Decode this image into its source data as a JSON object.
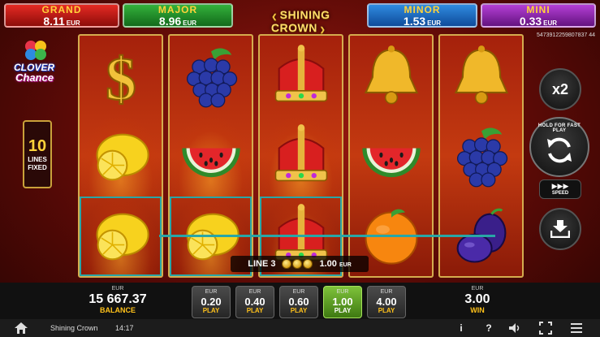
{
  "jackpots": {
    "grand": {
      "name": "GRAND",
      "value": "8.11",
      "currency": "EUR"
    },
    "major": {
      "name": "MAJOR",
      "value": "8.96",
      "currency": "EUR"
    },
    "minor": {
      "name": "MINOR",
      "value": "1.53",
      "currency": "EUR"
    },
    "mini": {
      "name": "MINI",
      "value": "0.33",
      "currency": "EUR"
    }
  },
  "game_title": "SHINING CROWN",
  "session_id": "5473912259807837 44",
  "logo": {
    "line1": "CLOVER",
    "line2": "Chance"
  },
  "lines_info": {
    "count": "10",
    "label1": "LINES",
    "label2": "FIXED"
  },
  "reels": [
    [
      "dollar",
      "lemon",
      "lemon"
    ],
    [
      "grapes",
      "watermelon",
      "lemon"
    ],
    [
      "crown",
      "crown",
      "crown"
    ],
    [
      "bell",
      "watermelon",
      "orange"
    ],
    [
      "bell",
      "grapes",
      "plum"
    ]
  ],
  "winning_line": {
    "label": "LINE 3",
    "amount": "1.00",
    "currency": "EUR"
  },
  "controls": {
    "multiplier": "x2",
    "hold_text": "HOLD FOR FAST PLAY",
    "speed_label": "SPEED",
    "speed_arrows": "▶▶▶"
  },
  "balance": {
    "currency": "EUR",
    "value": "15 667.37",
    "label": "BALANCE"
  },
  "bets": [
    {
      "currency": "EUR",
      "value": "0.20",
      "label": "PLAY",
      "selected": false
    },
    {
      "currency": "EUR",
      "value": "0.40",
      "label": "PLAY",
      "selected": false
    },
    {
      "currency": "EUR",
      "value": "0.60",
      "label": "PLAY",
      "selected": false
    },
    {
      "currency": "EUR",
      "value": "1.00",
      "label": "PLAY",
      "selected": true
    },
    {
      "currency": "EUR",
      "value": "4.00",
      "label": "PLAY",
      "selected": false
    }
  ],
  "win": {
    "currency": "EUR",
    "value": "3.00",
    "label": "WIN"
  },
  "status_bar": {
    "game_name": "Shining Crown",
    "time": "14:17"
  },
  "colors": {
    "accent": "#ffc21a",
    "win_line": "#29a6a6",
    "selected_bet": "#5a9d1f"
  }
}
